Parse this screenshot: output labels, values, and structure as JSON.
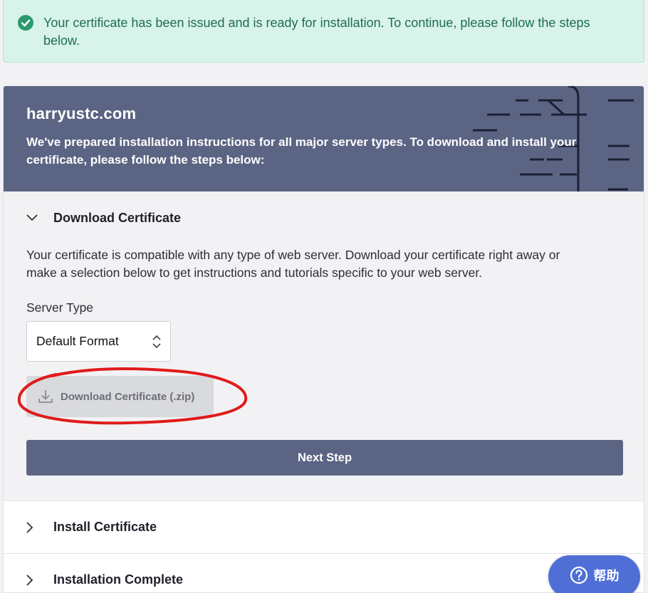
{
  "alert": {
    "message": "Your certificate has been issued and is ready for installation. To continue, please follow the steps below.",
    "color": "#1e6e50"
  },
  "card": {
    "domain": "harryustc.com",
    "subtitle": "We've prepared installation instructions for all major server types. To download and install your certificate, please follow the steps below:",
    "header_color": "#5b6483"
  },
  "steps": [
    {
      "title": "Download Certificate",
      "expanded": true,
      "description": "Your certificate is compatible with any type of web server. Download your certificate right away or make a selection below to get instructions and tutorials specific to your web server.",
      "server_type_label": "Server Type",
      "server_type_value": "Default Format",
      "download_label": "Download Certificate (.zip)",
      "next_label": "Next Step"
    },
    {
      "title": "Install Certificate",
      "expanded": false
    },
    {
      "title": "Installation Complete",
      "expanded": false
    }
  ],
  "help": {
    "label": "帮助",
    "color": "#4f6fd6"
  },
  "annotation": {
    "color": "#e01b1b"
  },
  "icons": {
    "alert": "check-circle-icon",
    "expand": "chevron-down-icon",
    "collapse": "chevron-right-icon",
    "select": "up-down-arrows-icon",
    "download": "download-icon",
    "help": "question-circle-icon"
  }
}
